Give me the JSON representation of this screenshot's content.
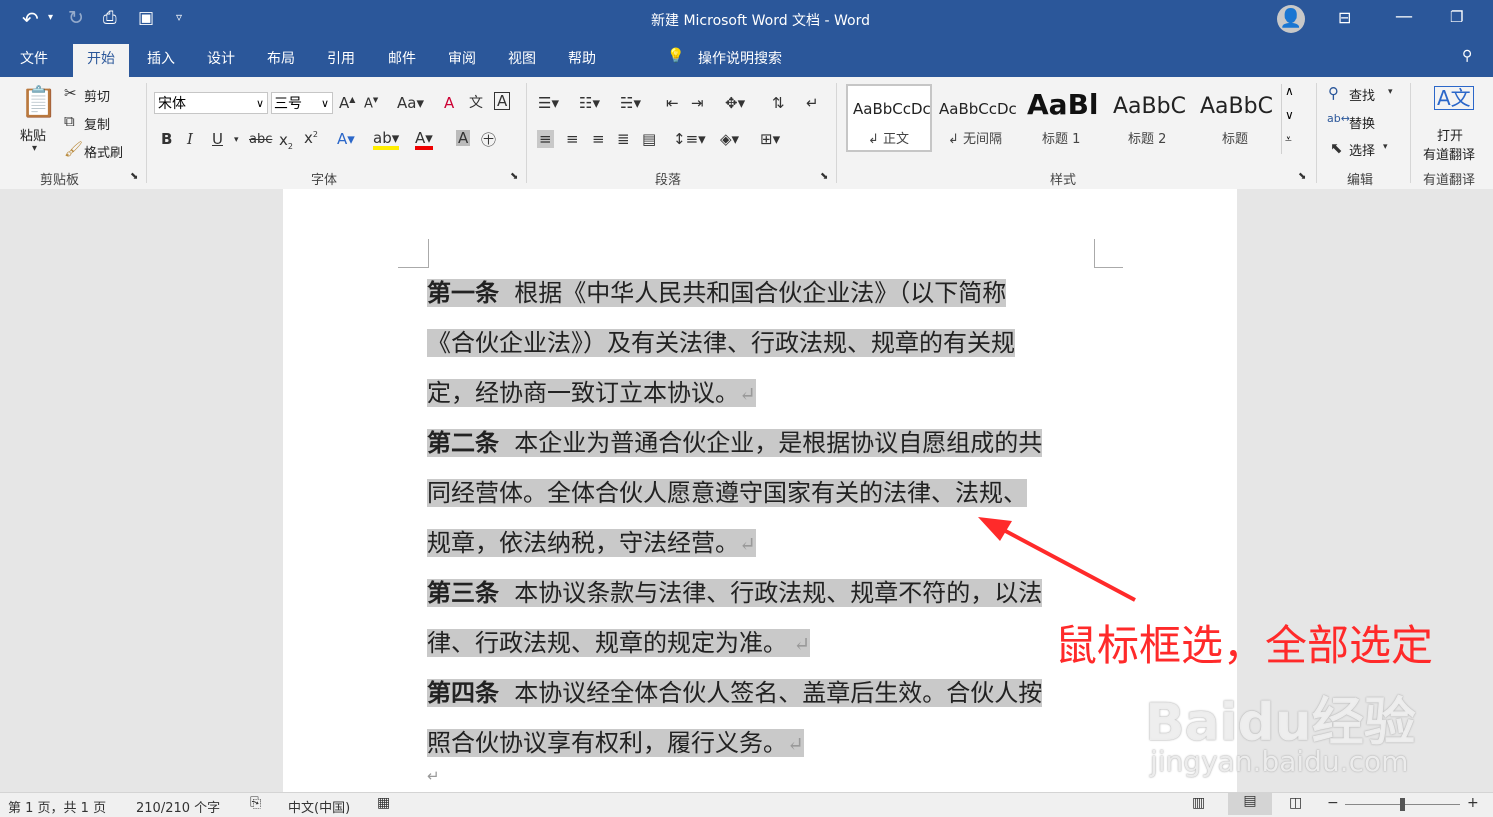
{
  "titlebar": {
    "title": "新建 Microsoft Word 文档 - Word"
  },
  "tabs": [
    "文件",
    "开始",
    "插入",
    "设计",
    "布局",
    "引用",
    "邮件",
    "审阅",
    "视图",
    "帮助"
  ],
  "tell_me": "操作说明搜索",
  "clipboard": {
    "paste": "粘贴",
    "cut": "剪切",
    "copy": "复制",
    "format_painter": "格式刷",
    "group": "剪贴板"
  },
  "font": {
    "name": "宋体",
    "size": "三号",
    "group": "字体"
  },
  "paragraph": {
    "group": "段落"
  },
  "styles": {
    "items": [
      {
        "preview": "AaBbCcDc",
        "name": "正文"
      },
      {
        "preview": "AaBbCcDc",
        "name": "无间隔"
      },
      {
        "preview": "AaBl",
        "name": "标题 1"
      },
      {
        "preview": "AaBbC",
        "name": "标题 2"
      },
      {
        "preview": "AaBbC",
        "name": "标题"
      }
    ],
    "group": "样式"
  },
  "editing": {
    "find": "查找",
    "replace": "替换",
    "select": "选择",
    "group": "编辑"
  },
  "youdao": {
    "open_line1": "打开",
    "open_line2": "有道翻译",
    "group": "有道翻译"
  },
  "document": {
    "lines": [
      {
        "bold": "第一条",
        "text": "根据《中华人民共和国合伙企业法》（以下简称",
        "mark": ""
      },
      {
        "bold": "",
        "text": "《合伙企业法》）及有关法律、行政法规、规章的有关规",
        "mark": ""
      },
      {
        "bold": "",
        "text": "定，经协商一致订立本协议。",
        "mark": "↵"
      },
      {
        "bold": "第二条",
        "text": "本企业为普通合伙企业，是根据协议自愿组成的共",
        "mark": ""
      },
      {
        "bold": "",
        "text": "同经营体。全体合伙人愿意遵守国家有关的法律、法规、",
        "mark": ""
      },
      {
        "bold": "",
        "text": "规章，依法纳税，守法经营。",
        "mark": "↵"
      },
      {
        "bold": "第三条",
        "text": "本协议条款与法律、行政法规、规章不符的，以法",
        "mark": ""
      },
      {
        "bold": "",
        "text": "律、行政法规、规章的规定为准。",
        "mark": " ↵"
      },
      {
        "bold": "第四条",
        "text": "本协议经全体合伙人签名、盖章后生效。合伙人按",
        "mark": ""
      },
      {
        "bold": "",
        "text": "照合伙协议享有权利，履行义务。",
        "mark": "↵"
      }
    ],
    "trailing_mark": "↵"
  },
  "annotation": "鼠标框选，全部选定",
  "watermark": {
    "brand": "Baidu经验",
    "url": "jingyan.baidu.com"
  },
  "status": {
    "page": "第 1 页，共 1 页",
    "words": "210/210 个字",
    "language": "中文(中国)"
  },
  "colors": {
    "accent": "#2b579a",
    "selection": "#c9c9c9",
    "annotation": "#ff2a2a"
  }
}
